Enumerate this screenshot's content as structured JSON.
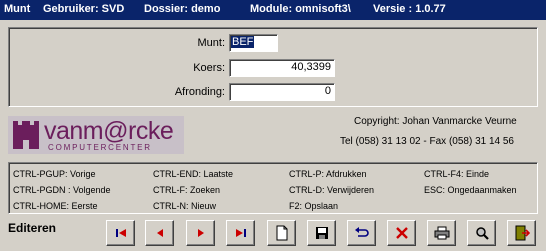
{
  "titlebar": {
    "module_name": "Munt",
    "user": "Gebruiker: SVD",
    "dossier": "Dossier: demo",
    "module": "Module: omnisoft3\\",
    "version": "Versie : 1.0.77"
  },
  "form": {
    "munt_label": "Munt:",
    "munt_value": "BEF",
    "koers_label": "Koers:",
    "koers_value": "40,3399",
    "afronding_label": "Afronding:",
    "afronding_value": "0"
  },
  "company": {
    "logo_word": "vanm@rcke",
    "logo_sub": "COMPUTERCENTER",
    "copyright": "Copyright:  Johan Vanmarcke  Veurne",
    "contact": "Tel (058) 31 13 02  -  Fax (058) 31 14 56"
  },
  "shortcuts": [
    "CTRL-PGUP: Vorige",
    "CTRL-END: Laatste",
    "CTRL-P: Afdrukken",
    "CTRL-F4: Einde",
    "CTRL-PGDN : Volgende",
    "CTRL-F: Zoeken",
    "CTRL-D: Verwijderen",
    "ESC: Ongedaanmaken",
    "CTRL-HOME: Eerste",
    "CTRL-N: Nieuw",
    "F2: Opslaan"
  ],
  "status": {
    "mode": "Editeren"
  },
  "toolbar": {
    "buttons": [
      "first-icon",
      "previous-icon",
      "next-icon",
      "last-icon",
      "new-icon",
      "save-icon",
      "undo-icon",
      "delete-icon",
      "print-icon",
      "search-icon",
      "exit-icon"
    ]
  },
  "colors": {
    "titlebar": "#0a246a",
    "background": "#d4d0c8",
    "logo_purple": "#6b1e5c",
    "accent_red": "#cc0000",
    "selection": "#0a246a"
  }
}
